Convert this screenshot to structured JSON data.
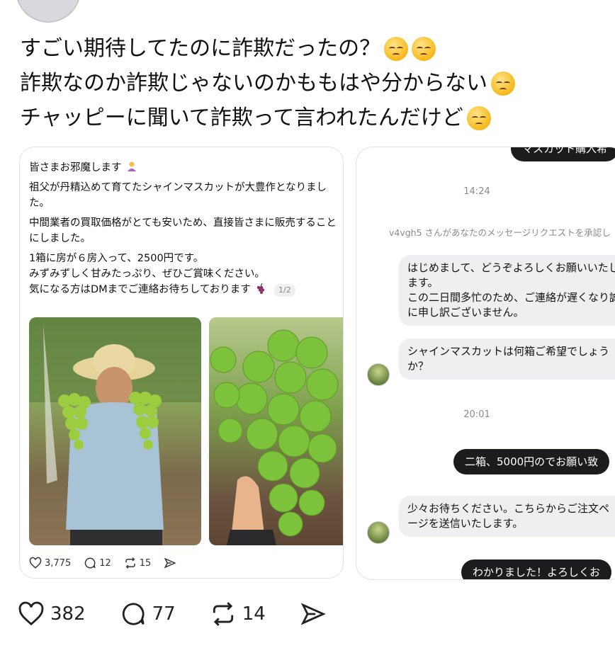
{
  "post": {
    "lines": [
      "すごい期待してたのに詐欺だったの？",
      "詐欺なのか詐欺じゃないのかももはや分からない",
      "チャッピーに聞いて詐欺って言われたんだけど"
    ],
    "emoji_name": "pensive-face"
  },
  "embedded_post": {
    "paragraphs": [
      "皆さまお邪魔します",
      "祖父が丹精込めて育てたシャインマスカットが大豊作となりました。",
      "中間業者の買取価格がとても安いため、直接皆さまに販売することにしました。",
      "1箱に房が６房入って、2500円です。",
      "みずみずしく甘みたっぷり、ぜひご賞味ください。",
      "気になる方はDMまでご連絡お待ちしております"
    ],
    "page_indicator": "1/2",
    "likes": "3,775",
    "replies": "12",
    "reposts": "15"
  },
  "dm": {
    "top_partial": "マスカット購入希",
    "time1": "14:24",
    "system": "v4vgh5 さんがあなたのメッセージリクエストを承認し",
    "msg1": "はじめまして、どうぞよろしくお願いいたします。\nこの二日間多忙のため、ご連絡が遅くなり誠に申し訳ございません。",
    "msg2": "シャインマスカットは何箱ご希望でしょうか？",
    "time2": "20:01",
    "out1": "二箱、5000円のでお願い致",
    "msg3": "少々お待ちください。こちらからご注文ページを送信いたします。",
    "out2": "わかりました！よろしくお"
  },
  "actions": {
    "likes": "382",
    "replies": "77",
    "reposts": "14"
  }
}
